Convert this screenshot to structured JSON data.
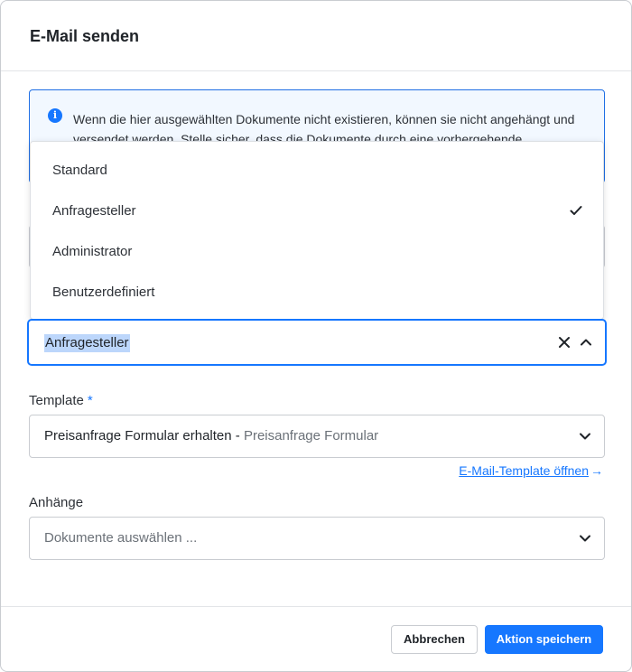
{
  "dialog": {
    "title": "E-Mail senden"
  },
  "info": {
    "icon": "info-icon",
    "text": "Wenn die hier ausgewählten Dokumente nicht existieren, können sie nicht angehängt und versendet werden. Stelle sicher, dass die Dokumente durch eine vorhergehende"
  },
  "recipient": {
    "selected_value": "Anfragesteller",
    "options": [
      {
        "label": "Standard",
        "selected": false
      },
      {
        "label": "Anfragesteller",
        "selected": true
      },
      {
        "label": "Administrator",
        "selected": false
      },
      {
        "label": "Benutzerdefiniert",
        "selected": false
      }
    ]
  },
  "template": {
    "label": "Template",
    "required_mark": "*",
    "value_main": "Preisanfrage Formular erhalten - ",
    "value_sub": "Preisanfrage Formular",
    "open_link": "E-Mail-Template öffnen",
    "open_link_arrow": "→"
  },
  "attachments": {
    "label": "Anhänge",
    "placeholder": "Dokumente auswählen ..."
  },
  "footer": {
    "cancel_label": "Abbrechen",
    "save_label": "Aktion speichern"
  },
  "colors": {
    "accent": "#1677ff",
    "selection_highlight": "#bcd6fb",
    "info_background": "#f2f8ff"
  }
}
